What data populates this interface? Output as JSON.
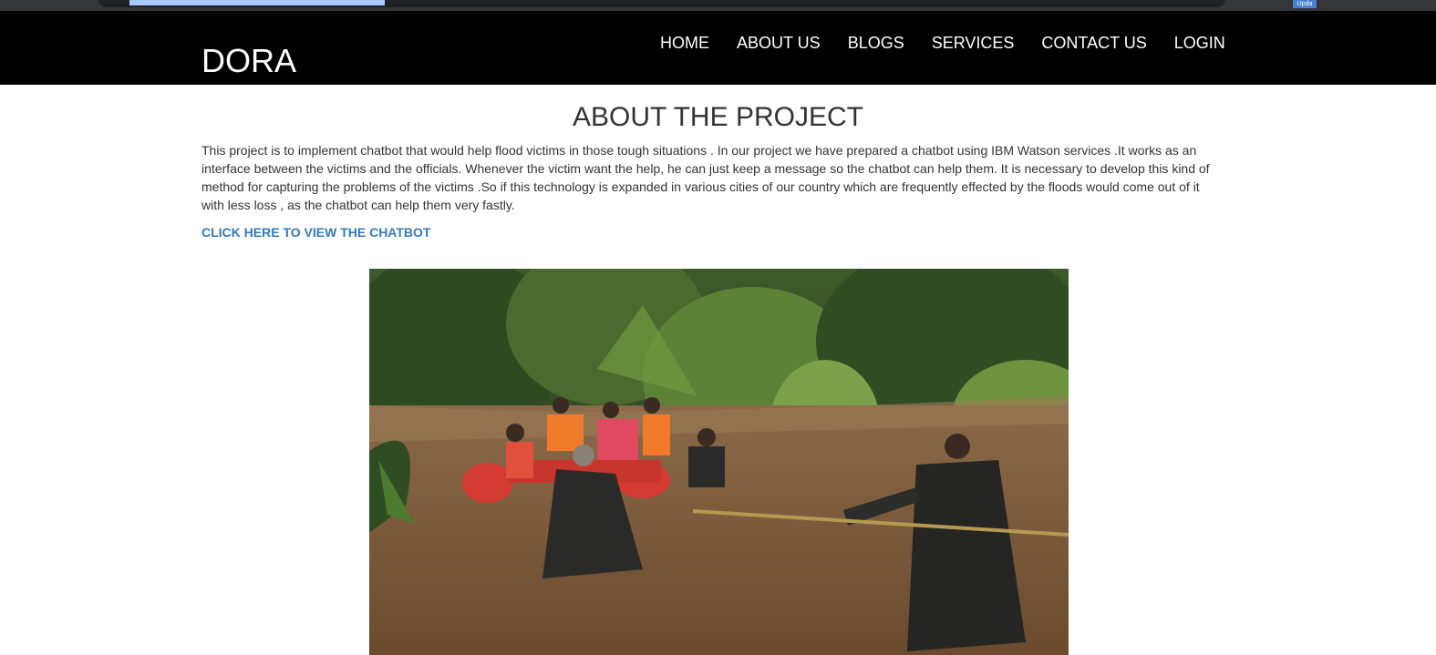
{
  "browser": {
    "update_badge": "Upda"
  },
  "navbar": {
    "brand": "DORA",
    "links": [
      {
        "label": "HOME"
      },
      {
        "label": "ABOUT US"
      },
      {
        "label": "BLOGS"
      },
      {
        "label": "SERVICES"
      },
      {
        "label": "CONTACT US"
      },
      {
        "label": "LOGIN"
      }
    ]
  },
  "main": {
    "title": "ABOUT THE PROJECT",
    "description": "This project is to implement chatbot that would help flood victims in those tough situations . In our project we have prepared a chatbot using IBM Watson services .It works as an interface between the victims and the officials. Whenever the victim want the help, he can just keep a message so the chatbot can help them. It is necessary to develop this kind of method for capturing the problems of the victims .So if this technology is expanded in various cities of our country which are frequently effected by the floods would come out of it with less loss , as the chatbot can help them very fastly.",
    "chatbot_link": "CLICK HERE TO VIEW THE CHATBOT"
  },
  "colors": {
    "navbar_bg": "#000000",
    "link_blue": "#337ab7",
    "text": "#333333"
  }
}
